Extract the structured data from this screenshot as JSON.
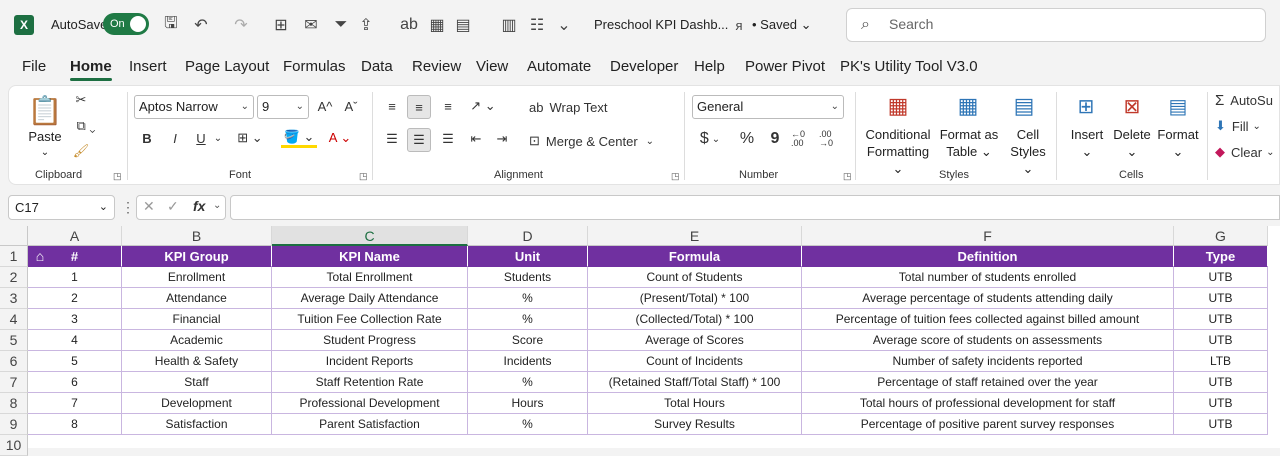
{
  "titlebar": {
    "app_icon": "X",
    "autosave_label": "AutoSave",
    "autosave_state": "On",
    "doc_title": "Preschool KPI Dashb...",
    "saved_status": "• Saved",
    "search_placeholder": "Search"
  },
  "tabs": [
    "File",
    "Home",
    "Insert",
    "Page Layout",
    "Formulas",
    "Data",
    "Review",
    "View",
    "Automate",
    "Developer",
    "Help",
    "Power Pivot",
    "PK's Utility Tool V3.0"
  ],
  "active_tab": "Home",
  "ribbon": {
    "clipboard": {
      "paste": "Paste",
      "group": "Clipboard"
    },
    "font": {
      "name": "Aptos Narrow",
      "size": "9",
      "group": "Font",
      "bold": "B",
      "italic": "I",
      "underline": "U"
    },
    "alignment": {
      "wrap": "Wrap Text",
      "merge": "Merge & Center",
      "group": "Alignment"
    },
    "number": {
      "format": "General",
      "currency": "$",
      "percent": "%",
      "comma": "9",
      "inc": "←0 .00",
      "dec": ".00 →0",
      "group": "Number"
    },
    "styles": {
      "cond1": "Conditional",
      "cond2": "Formatting",
      "fmt1": "Format as",
      "fmt2": "Table",
      "cell1": "Cell",
      "cell2": "Styles",
      "group": "Styles"
    },
    "cells": {
      "insert": "Insert",
      "delete": "Delete",
      "format": "Format",
      "group": "Cells"
    },
    "editing": {
      "autosum": "AutoSu",
      "fill": "Fill",
      "clear": "Clear"
    }
  },
  "formula_bar": {
    "name_box": "C17",
    "fx": "fx",
    "formula": ""
  },
  "columns": [
    "A",
    "B",
    "C",
    "D",
    "E",
    "F",
    "G"
  ],
  "selected_column": "C",
  "rows": [
    "1",
    "2",
    "3",
    "4",
    "5",
    "6",
    "7",
    "8",
    "9",
    "10"
  ],
  "table": {
    "headers": [
      "#",
      "KPI Group",
      "KPI Name",
      "Unit",
      "Formula",
      "Definition",
      "Type"
    ],
    "rows": [
      [
        "1",
        "Enrollment",
        "Total Enrollment",
        "Students",
        "Count of Students",
        "Total number of students enrolled",
        "UTB"
      ],
      [
        "2",
        "Attendance",
        "Average Daily Attendance",
        "%",
        "(Present/Total) * 100",
        "Average percentage of students attending daily",
        "UTB"
      ],
      [
        "3",
        "Financial",
        "Tuition Fee Collection Rate",
        "%",
        "(Collected/Total) * 100",
        "Percentage of tuition fees collected against billed amount",
        "UTB"
      ],
      [
        "4",
        "Academic",
        "Student Progress",
        "Score",
        "Average of Scores",
        "Average score of students on assessments",
        "UTB"
      ],
      [
        "5",
        "Health & Safety",
        "Incident Reports",
        "Incidents",
        "Count of Incidents",
        "Number of safety incidents reported",
        "LTB"
      ],
      [
        "6",
        "Staff",
        "Staff Retention Rate",
        "%",
        "(Retained Staff/Total Staff) * 100",
        "Percentage of staff retained over the year",
        "UTB"
      ],
      [
        "7",
        "Development",
        "Professional Development",
        "Hours",
        "Total Hours",
        "Total hours of professional development for staff",
        "UTB"
      ],
      [
        "8",
        "Satisfaction",
        "Parent Satisfaction",
        "%",
        "Survey Results",
        "Percentage of positive parent survey responses",
        "UTB"
      ]
    ]
  },
  "colors": {
    "header_fill": "#7030a0",
    "accent": "#1d6f42"
  }
}
